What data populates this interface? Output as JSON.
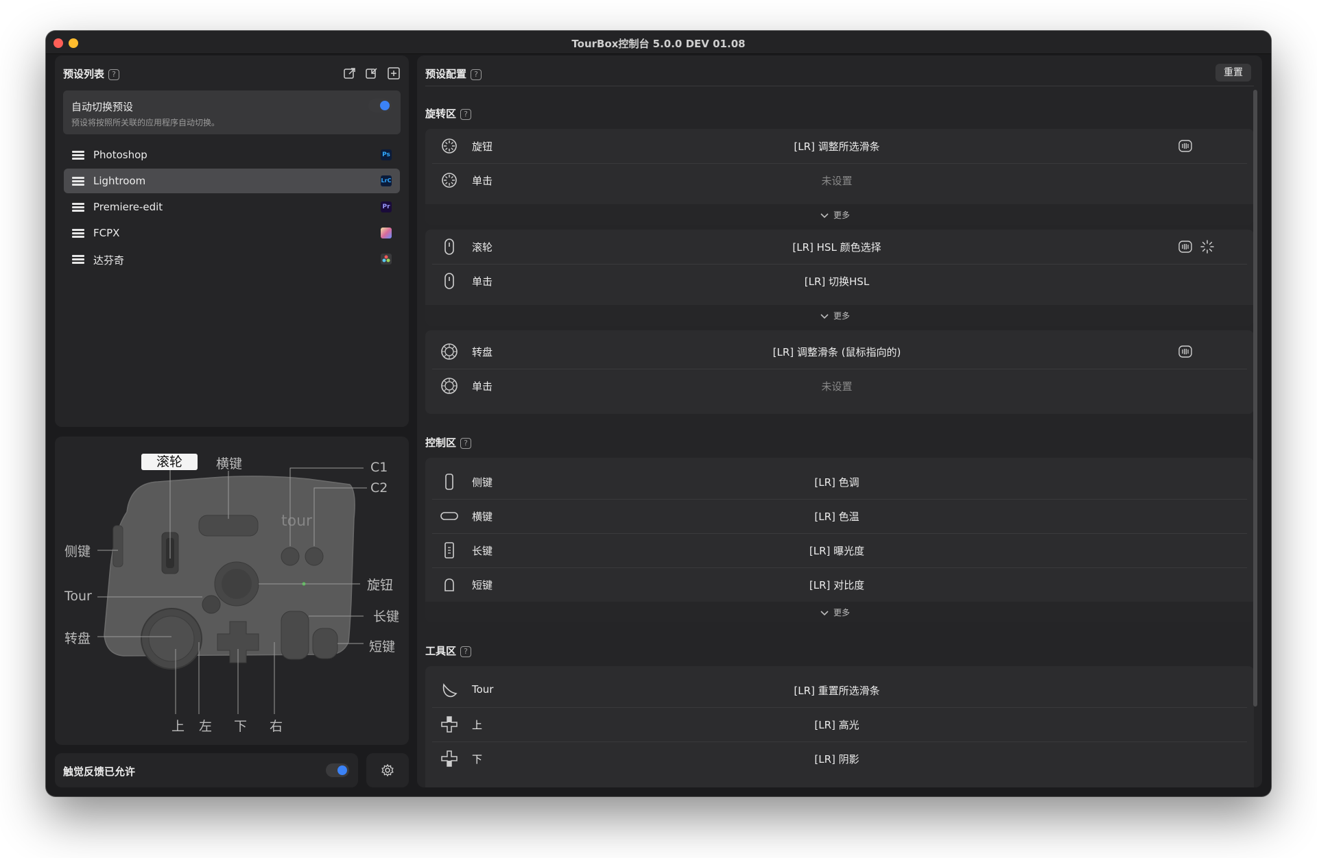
{
  "window": {
    "title": "TourBox控制台 5.0.0 DEV 01.08"
  },
  "preset_list": {
    "title": "预设列表",
    "help": "?",
    "auto_switch": {
      "title": "自动切换预设",
      "description": "预设将按照所关联的应用程序自动切换。",
      "enabled": true
    },
    "items": [
      {
        "label": "Photoshop",
        "icon": "photoshop-icon",
        "badge": "Ps",
        "active": false
      },
      {
        "label": "Lightroom",
        "icon": "lightroom-icon",
        "badge": "LrC",
        "active": true
      },
      {
        "label": "Premiere-edit",
        "icon": "premiere-icon",
        "badge": "Pr",
        "active": false
      },
      {
        "label": "FCPX",
        "icon": "fcpx-icon",
        "badge": "",
        "active": false
      },
      {
        "label": "达芬奇",
        "icon": "davinci-icon",
        "badge": "",
        "active": false
      }
    ]
  },
  "device_diagram": {
    "tabs": {
      "active": "滚轮",
      "other": "横键"
    },
    "labels": {
      "c1": "C1",
      "c2": "C2",
      "side": "侧键",
      "tour": "Tour",
      "dial": "转盘",
      "knob": "旋钮",
      "tall": "长键",
      "short": "短键",
      "up": "上",
      "left": "左",
      "down": "下",
      "right": "右"
    }
  },
  "footer": {
    "haptic_label": "触觉反馈已允许",
    "haptic_enabled": true
  },
  "config": {
    "title": "预设配置",
    "help": "?",
    "reset_label": "重置",
    "more_label": "更多",
    "sections": {
      "rotate": {
        "title": "旋转区"
      },
      "control": {
        "title": "控制区"
      },
      "tool": {
        "title": "工具区"
      }
    },
    "rotate_cards": [
      {
        "rows": [
          {
            "label": "旋钮",
            "value": "[LR] 调整所选滑条",
            "haptic": true
          },
          {
            "label": "单击",
            "value": "未设置"
          }
        ]
      },
      {
        "rows": [
          {
            "label": "滚轮",
            "value": "[LR] HSL 颜色选择",
            "haptic": true
          },
          {
            "label": "单击",
            "value": "[LR] 切换HSL"
          }
        ]
      },
      {
        "rows": [
          {
            "label": "转盘",
            "value": "[LR] 调整滑条 (鼠标指向的)",
            "haptic": true
          },
          {
            "label": "单击",
            "value": "未设置"
          }
        ]
      }
    ],
    "control_rows": [
      {
        "label": "侧键",
        "value": "[LR] 色调"
      },
      {
        "label": "横键",
        "value": "[LR] 色温"
      },
      {
        "label": "长键",
        "value": "[LR] 曝光度"
      },
      {
        "label": "短键",
        "value": "[LR] 对比度"
      }
    ],
    "tool_rows": [
      {
        "label": "Tour",
        "value": "[LR] 重置所选滑条"
      },
      {
        "label": "上",
        "value": "[LR] 高光"
      },
      {
        "label": "下",
        "value": "[LR] 阴影"
      }
    ]
  }
}
